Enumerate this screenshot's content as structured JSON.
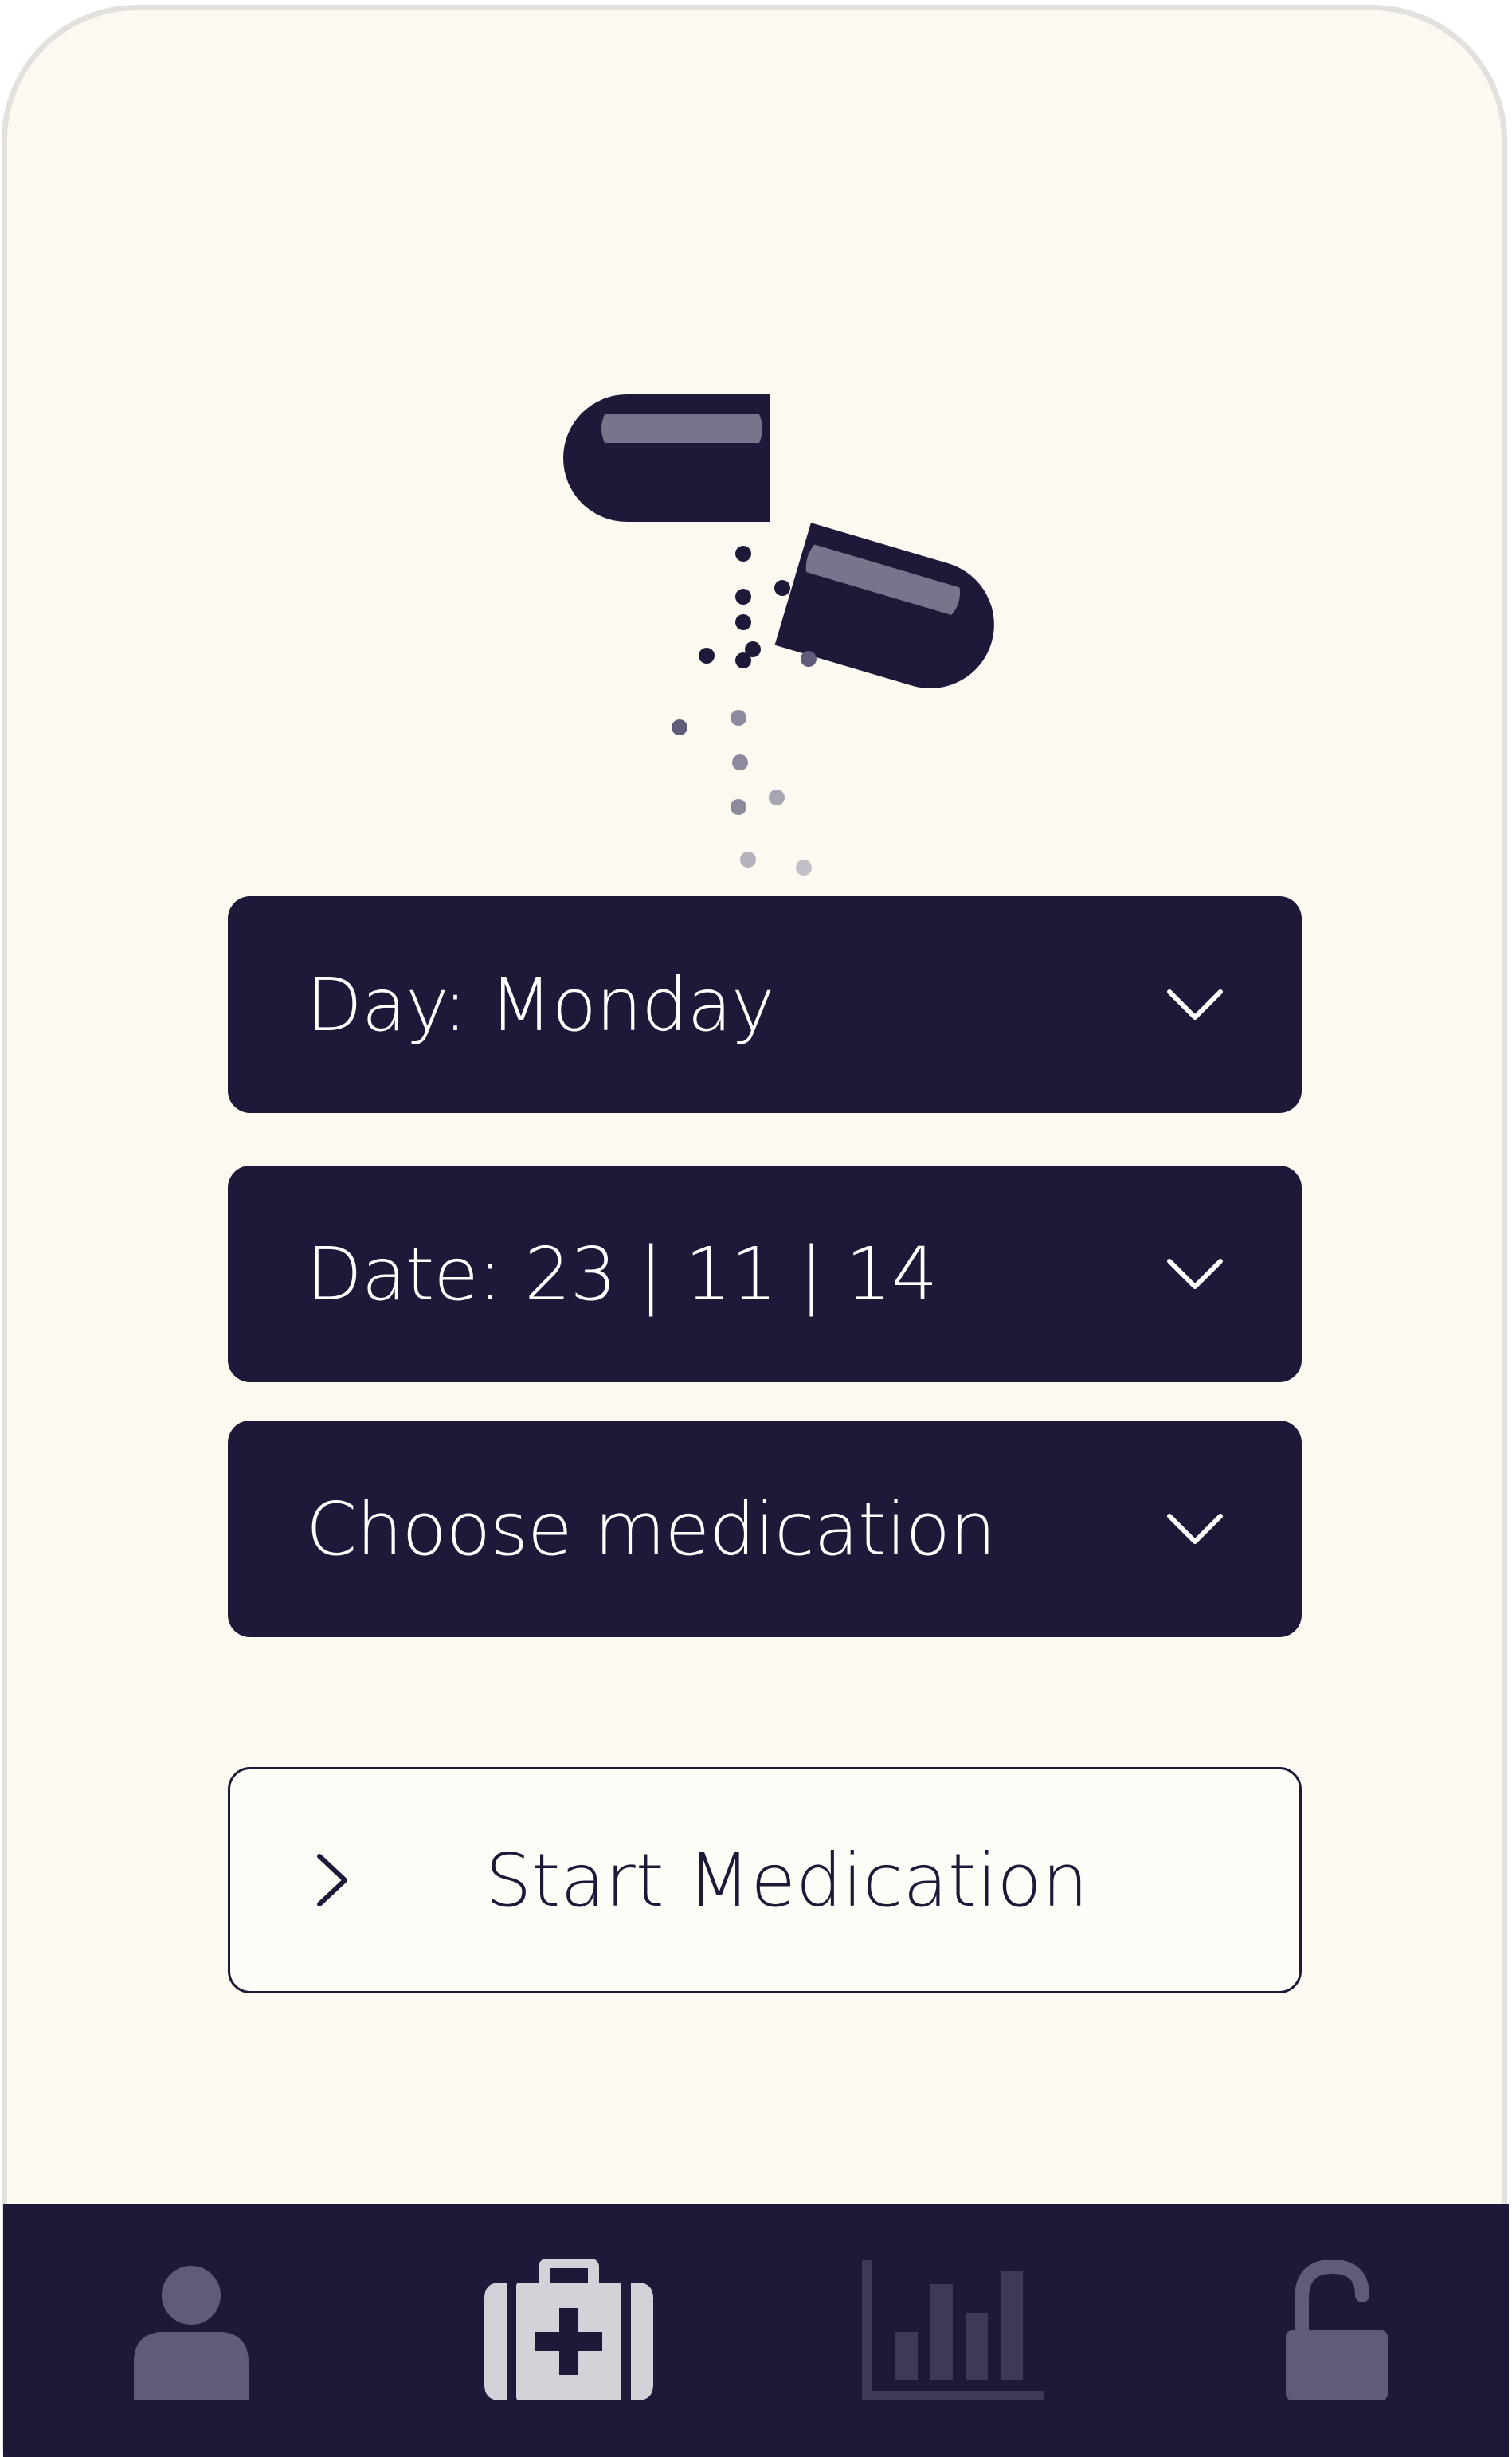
{
  "form": {
    "day": {
      "label": "Day:  Monday"
    },
    "date": {
      "label": "Date:  23 | 11 | 14"
    },
    "medication": {
      "label": "Choose medication"
    },
    "start": {
      "label": "Start Medication"
    }
  },
  "tabbar": {
    "tabs": [
      {
        "icon": "user-icon",
        "active": false
      },
      {
        "icon": "medical-kit-icon",
        "active": true
      },
      {
        "icon": "bar-chart-icon",
        "active": false
      },
      {
        "icon": "unlock-icon",
        "active": false
      }
    ]
  },
  "colors": {
    "primary": "#1e1939",
    "background": "#fdf9f1",
    "icon_active": "#d3d2d8",
    "icon_inactive": "#615b79"
  }
}
